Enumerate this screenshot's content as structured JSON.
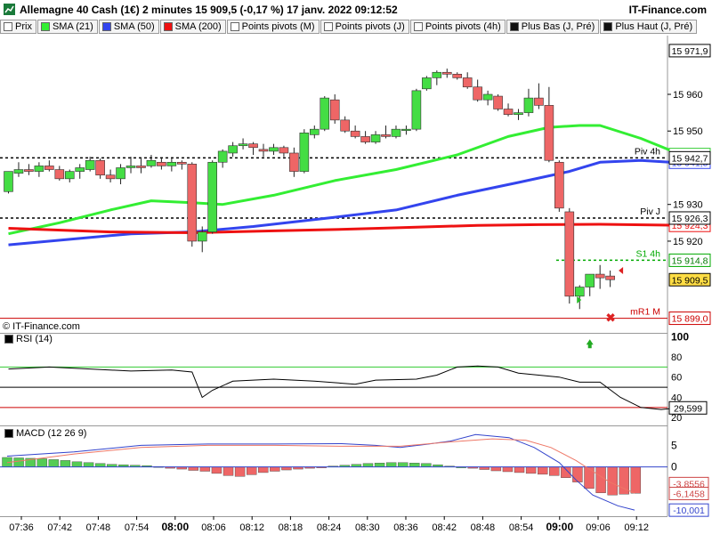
{
  "header": {
    "title": "Allemagne 40 Cash (1€) 2 minutes 15 909,5 (-0,17 %) 17 janv. 2022 09:12:52",
    "brand": "IT-Finance.com"
  },
  "legend": [
    {
      "label": "Prix",
      "color": "#ffffff"
    },
    {
      "label": "SMA (21)",
      "color": "#33ee33"
    },
    {
      "label": "SMA (50)",
      "color": "#3344ee"
    },
    {
      "label": "SMA (200)",
      "color": "#ee1111"
    },
    {
      "label": "Points pivots (M)",
      "color": "#ffffff"
    },
    {
      "label": "Points pivots (J)",
      "color": "#ffffff"
    },
    {
      "label": "Points pivots (4h)",
      "color": "#ffffff"
    },
    {
      "label": "Plus Bas (J, Pré)",
      "color": "#111111"
    },
    {
      "label": "Plus Haut (J, Pré)",
      "color": "#111111"
    }
  ],
  "copyright": "© IT-Finance.com",
  "chart_data": [
    {
      "type": "candlestick",
      "name": "price",
      "x_ticks": [
        "07:36",
        "07:42",
        "07:48",
        "07:54",
        "08:00",
        "08:06",
        "08:12",
        "08:18",
        "08:24",
        "08:30",
        "08:36",
        "08:42",
        "08:48",
        "08:54",
        "09:00",
        "09:06",
        "09:12"
      ],
      "bold_ticks": [
        "08:00",
        "09:00"
      ],
      "ylim": [
        15895.5,
        15976
      ],
      "y_ticks": [
        {
          "value": 15960,
          "label": "15 960"
        },
        {
          "value": 15950,
          "label": "15 950"
        },
        {
          "value": 15930,
          "label": "15 930"
        },
        {
          "value": 15920,
          "label": "15 920"
        }
      ],
      "candles": [
        [
          15933.5,
          15939,
          15933,
          15939
        ],
        [
          15938.5,
          15941.5,
          15937.5,
          15939.5
        ],
        [
          15939.5,
          15941,
          15938,
          15939
        ],
        [
          15939,
          15941.5,
          15937.5,
          15940.5
        ],
        [
          15940.5,
          15942,
          15939,
          15939.5
        ],
        [
          15939.5,
          15940.5,
          15936.5,
          15937
        ],
        [
          15937,
          15939.5,
          15936,
          15939
        ],
        [
          15939,
          15941,
          15937,
          15940
        ],
        [
          15939.5,
          15943,
          15939,
          15942
        ],
        [
          15942,
          15942.5,
          15937,
          15938
        ],
        [
          15938,
          15939.5,
          15936,
          15937
        ],
        [
          15937,
          15941,
          15935.5,
          15940
        ],
        [
          15940,
          15943,
          15938.5,
          15940.5
        ],
        [
          15940.5,
          15942.5,
          15938.5,
          15940
        ],
        [
          15940.5,
          15943.5,
          15940,
          15942
        ],
        [
          15941.5,
          15942.5,
          15939.5,
          15940.5
        ],
        [
          15940.5,
          15942.5,
          15939,
          15941.5
        ],
        [
          15941.5,
          15942,
          15939.5,
          15941
        ],
        [
          15941,
          15941.5,
          15918.5,
          15920
        ],
        [
          15920,
          15924,
          15917,
          15922.5
        ],
        [
          15922.5,
          15942,
          15922,
          15941.5
        ],
        [
          15941.5,
          15945,
          15940,
          15944.5
        ],
        [
          15944,
          15947,
          15943,
          15946
        ],
        [
          15946,
          15948,
          15945,
          15946.5
        ],
        [
          15946.5,
          15947,
          15943.5,
          15945.5
        ],
        [
          15945,
          15946.5,
          15943,
          15944.5
        ],
        [
          15944.5,
          15946.5,
          15943.5,
          15945.5
        ],
        [
          15945.5,
          15946,
          15943,
          15944
        ],
        [
          15944,
          15945.5,
          15937.5,
          15939
        ],
        [
          15939,
          15950.5,
          15938.5,
          15949.5
        ],
        [
          15949,
          15951.5,
          15948,
          15950.5
        ],
        [
          15950.5,
          15959.5,
          15950,
          15959
        ],
        [
          15958.5,
          15960,
          15952,
          15953
        ],
        [
          15953,
          15954,
          15949.5,
          15950
        ],
        [
          15950,
          15951.5,
          15948,
          15948.5
        ],
        [
          15948.5,
          15950,
          15946.5,
          15947
        ],
        [
          15947,
          15950,
          15946.5,
          15949
        ],
        [
          15949,
          15951.5,
          15948,
          15948.5
        ],
        [
          15948.5,
          15951.5,
          15948,
          15950.5
        ],
        [
          15950.5,
          15951.5,
          15949,
          15950.5
        ],
        [
          15950.5,
          15961.5,
          15950,
          15961
        ],
        [
          15961.5,
          15965,
          15961,
          15964.5
        ],
        [
          15964.5,
          15966.5,
          15962.5,
          15966
        ],
        [
          15966,
          15967,
          15964.5,
          15965.5
        ],
        [
          15965.5,
          15966,
          15964,
          15964.5
        ],
        [
          15964.5,
          15966,
          15961.5,
          15962
        ],
        [
          15962,
          15964,
          15958,
          15958.5
        ],
        [
          15958.5,
          15961,
          15957,
          15960
        ],
        [
          15959.5,
          15960,
          15955.5,
          15956
        ],
        [
          15956,
          15957.5,
          15954,
          15954.5
        ],
        [
          15954.5,
          15956,
          15953,
          15955
        ],
        [
          15955,
          15961.5,
          15954,
          15959
        ],
        [
          15959,
          15963,
          15956,
          15957
        ],
        [
          15957,
          15962,
          15941.5,
          15942
        ],
        [
          15941.5,
          15942,
          15928,
          15929
        ],
        [
          15928,
          15929,
          15903,
          15905
        ],
        [
          15905,
          15908,
          15901.5,
          15907.5
        ],
        [
          15907.5,
          15911,
          15905,
          15911
        ],
        [
          15911,
          15913.5,
          15907,
          15910
        ],
        [
          15910.5,
          15912,
          15907.5,
          15909.5
        ]
      ],
      "series": [
        {
          "name": "SMA (21)",
          "color": "#33ee33",
          "values": [
            [
              0,
              15922
            ],
            [
              5,
              15925
            ],
            [
              10,
              15928.5
            ],
            [
              14,
              15931
            ],
            [
              18,
              15930.5
            ],
            [
              21,
              15930
            ],
            [
              26,
              15932.5
            ],
            [
              32,
              15936.5
            ],
            [
              38,
              15939.5
            ],
            [
              44,
              15943.5
            ],
            [
              49,
              15948.5
            ],
            [
              53,
              15951
            ],
            [
              56,
              15951.5
            ],
            [
              58,
              15951.5
            ],
            [
              62,
              15948
            ],
            [
              66,
              15943.5
            ]
          ]
        },
        {
          "name": "SMA (50)",
          "color": "#3344ee",
          "values": [
            [
              0,
              15919
            ],
            [
              6,
              15920.5
            ],
            [
              12,
              15922
            ],
            [
              18,
              15922.5
            ],
            [
              24,
              15924
            ],
            [
              32,
              15926.5
            ],
            [
              38,
              15928.5
            ],
            [
              44,
              15932.5
            ],
            [
              50,
              15936
            ],
            [
              55,
              15939
            ],
            [
              58,
              15941.5
            ],
            [
              62,
              15942
            ],
            [
              66,
              15941.3
            ]
          ]
        },
        {
          "name": "SMA (200)",
          "color": "#ee1111",
          "values": [
            [
              0,
              15923.5
            ],
            [
              10,
              15922.5
            ],
            [
              18,
              15922.3
            ],
            [
              26,
              15922.8
            ],
            [
              34,
              15923.3
            ],
            [
              40,
              15923.8
            ],
            [
              46,
              15924.3
            ],
            [
              52,
              15924.5
            ],
            [
              58,
              15924.6
            ],
            [
              66,
              15924.3
            ]
          ]
        }
      ],
      "levels": [
        {
          "label": "Piv 4h",
          "value": 15942.7,
          "tag": "15 942,7",
          "color": "#000000",
          "dash": "3,3",
          "tag_bg": "#ffffff",
          "tag_fg": "#000000"
        },
        {
          "label": "Piv J",
          "value": 15926.3,
          "tag": "15 926,3",
          "color": "#000000",
          "dash": "3,3",
          "tag_bg": "#ffffff",
          "tag_fg": "#000000"
        },
        {
          "label": "S1 4h",
          "value": 15914.8,
          "tag": "15 914,8",
          "color": "#00aa00",
          "dash": "3,3",
          "tag_bg": "#ffffff",
          "tag_fg": "#007700"
        },
        {
          "label": "mR1 M",
          "value": 15899.0,
          "tag": "15 899,0",
          "color": "#cc0000",
          "dash": "",
          "tag_bg": "#ffffff",
          "tag_fg": "#cc0000"
        }
      ],
      "right_tags": [
        {
          "value": 15971.9,
          "text": "15 971,9",
          "bg": "#ffffff",
          "fg": "#000000",
          "border": "#000000"
        },
        {
          "value": 15943.6,
          "text": "15 943,6",
          "bg": "#ffffff",
          "fg": "#33cc33",
          "border": "#33cc33"
        },
        {
          "value": 15941.5,
          "text": "15 941,5",
          "bg": "#ffffff",
          "fg": "#3344ee",
          "border": "#3344ee"
        },
        {
          "value": 15924.3,
          "text": "15 924,3",
          "bg": "#ffffff",
          "fg": "#ee1111",
          "border": "#ee1111"
        },
        {
          "value": 15909.5,
          "text": "15 909,5",
          "bg": "#ffdd44",
          "fg": "#000000",
          "border": "#000000"
        }
      ]
    },
    {
      "type": "line",
      "name": "RSI (14)",
      "title": "RSI (14)",
      "ylim": [
        14,
        102
      ],
      "y_ticks": [
        100,
        80,
        60,
        40,
        20
      ],
      "levels": [
        {
          "value": 70,
          "color": "#33cc33"
        },
        {
          "value": 50,
          "color": "#000000"
        },
        {
          "value": 30,
          "color": "#cc0000"
        }
      ],
      "last_value": "29,599",
      "values": [
        [
          0,
          68
        ],
        [
          4,
          70
        ],
        [
          8,
          68
        ],
        [
          12,
          66
        ],
        [
          16,
          67
        ],
        [
          18,
          65
        ],
        [
          19,
          40
        ],
        [
          20,
          47
        ],
        [
          22,
          56
        ],
        [
          26,
          58
        ],
        [
          30,
          56
        ],
        [
          34,
          53
        ],
        [
          36,
          57
        ],
        [
          40,
          58
        ],
        [
          42,
          62
        ],
        [
          44,
          70
        ],
        [
          46,
          71
        ],
        [
          48,
          70
        ],
        [
          50,
          64
        ],
        [
          54,
          60
        ],
        [
          56,
          55
        ],
        [
          58,
          55
        ],
        [
          60,
          40
        ],
        [
          62,
          30
        ],
        [
          64,
          28
        ],
        [
          66,
          30
        ],
        [
          67,
          29.6
        ]
      ]
    },
    {
      "type": "bar+line",
      "name": "MACD (12 26 9)",
      "title": "MACD (12 26 9)",
      "ylim": [
        -11,
        9
      ],
      "y_ticks": [
        {
          "value": 5,
          "label": "5"
        },
        {
          "value": 0,
          "label": "0"
        }
      ],
      "tags": [
        {
          "value": -3.8556,
          "text": "-3,8556",
          "color": "#cc4444"
        },
        {
          "value": -6.1458,
          "text": "-6,1458",
          "color": "#cc4444"
        },
        {
          "value": -10.001,
          "text": "-10,001",
          "color": "#3344cc"
        }
      ],
      "histogram": [
        2.2,
        2.1,
        2.0,
        1.9,
        1.7,
        1.5,
        1.2,
        1.0,
        0.8,
        0.6,
        0.5,
        0.4,
        0.3,
        0.1,
        -0.3,
        -0.5,
        -0.8,
        -1.0,
        -1.5,
        -2.0,
        -2.2,
        -1.8,
        -1.3,
        -1.0,
        -0.7,
        -0.5,
        -0.3,
        -0.1,
        0.2,
        0.4,
        0.6,
        0.8,
        0.9,
        1.0,
        1.0,
        0.9,
        0.8,
        0.5,
        0.2,
        0.0,
        -0.3,
        -0.6,
        -0.9,
        -1.1,
        -1.3,
        -1.5,
        -1.7,
        -2.0,
        -2.5,
        -3.5,
        -5.0,
        -6.0,
        -6.5,
        -6.3,
        -6.1
      ],
      "series": [
        {
          "name": "MACD",
          "color": "#3344cc",
          "values": [
            [
              0,
              2.5
            ],
            [
              8,
              3.5
            ],
            [
              16,
              5.0
            ],
            [
              24,
              5.3
            ],
            [
              32,
              5.3
            ],
            [
              40,
              5.4
            ],
            [
              44,
              5.0
            ],
            [
              47,
              4.5
            ],
            [
              50,
              5.2
            ],
            [
              53,
              6.0
            ],
            [
              56,
              7.5
            ],
            [
              60,
              6.8
            ],
            [
              63,
              4.5
            ],
            [
              66,
              1.0
            ],
            [
              68,
              -3.0
            ],
            [
              70,
              -6.5
            ],
            [
              73,
              -9.0
            ],
            [
              75,
              -10.0
            ]
          ]
        },
        {
          "name": "Signal",
          "color": "#ee7766",
          "values": [
            [
              0,
              1.0
            ],
            [
              8,
              3.0
            ],
            [
              16,
              4.5
            ],
            [
              24,
              5.0
            ],
            [
              32,
              5.0
            ],
            [
              40,
              4.8
            ],
            [
              47,
              4.8
            ],
            [
              53,
              5.8
            ],
            [
              58,
              6.5
            ],
            [
              62,
              6.2
            ],
            [
              65,
              4.5
            ],
            [
              68,
              1.5
            ],
            [
              70,
              -1.0
            ],
            [
              72,
              -3.5
            ],
            [
              75,
              -6.1
            ]
          ]
        }
      ]
    }
  ]
}
